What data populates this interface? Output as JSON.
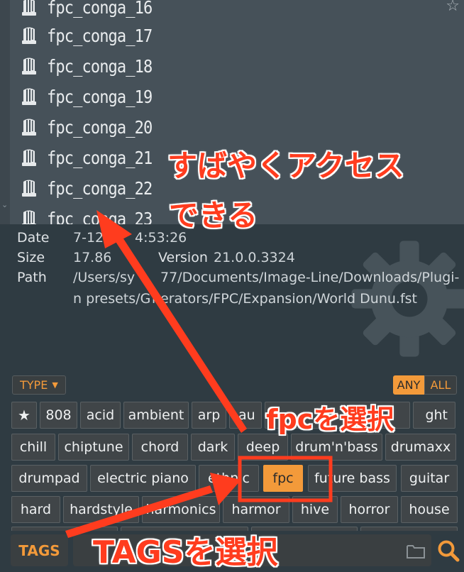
{
  "colors": {
    "accent": "#f39a3a",
    "annotation": "#ff3c1e",
    "list_bg": "#465159",
    "panel_bg": "#2f3b42"
  },
  "file_list": {
    "items": [
      "fpc_conga_16",
      "fpc_conga_17",
      "fpc_conga_18",
      "fpc_conga_19",
      "fpc_conga_20",
      "fpc_conga_21",
      "fpc_conga_22",
      "fpc_conga_23"
    ],
    "item_icon": "knob-icon",
    "favorite_icon": "star-icon",
    "favorite_glyph": "☆"
  },
  "info": {
    "date_label": "Date",
    "date_value": "7-12",
    "time_value": "4:53:26",
    "size_label": "Size",
    "size_value": "17.86",
    "version_label": "Version",
    "version_value": "21.0.0.3324",
    "path_label": "Path",
    "path_line1_a": "/Users/sy",
    "path_line1_b": "77/Documents/Image-Line/Downloads/Plugi-",
    "path_line2_a": "n presets/G",
    "path_line2_b": "nerators/FPC/Expansion/World Dunu.fst"
  },
  "filter": {
    "type_label": "TYPE",
    "any_label": "ANY",
    "all_label": "ALL",
    "tags": {
      "row1": [
        "★",
        "808",
        "acid",
        "ambient",
        "arp",
        "au",
        "",
        "ght"
      ],
      "row2": [
        "chill",
        "chiptune",
        "chord",
        "dark",
        "deep",
        "drum'n'bass",
        "drumaxx"
      ],
      "row3": [
        "drumpad",
        "electric piano",
        "ethnic",
        "fpc",
        "future bass",
        "guitar"
      ],
      "row4": [
        "hard",
        "hardstyle",
        "harmonics",
        "harmor",
        "hive",
        "horror",
        "house"
      ]
    },
    "selected_tag": "fpc"
  },
  "bottom": {
    "tags_label": "TAGS"
  },
  "annotations": {
    "line1": "すばやくアクセス",
    "line2": "できる",
    "select_fpc": "fpcを選択",
    "select_tags": "TAGSを選択"
  }
}
